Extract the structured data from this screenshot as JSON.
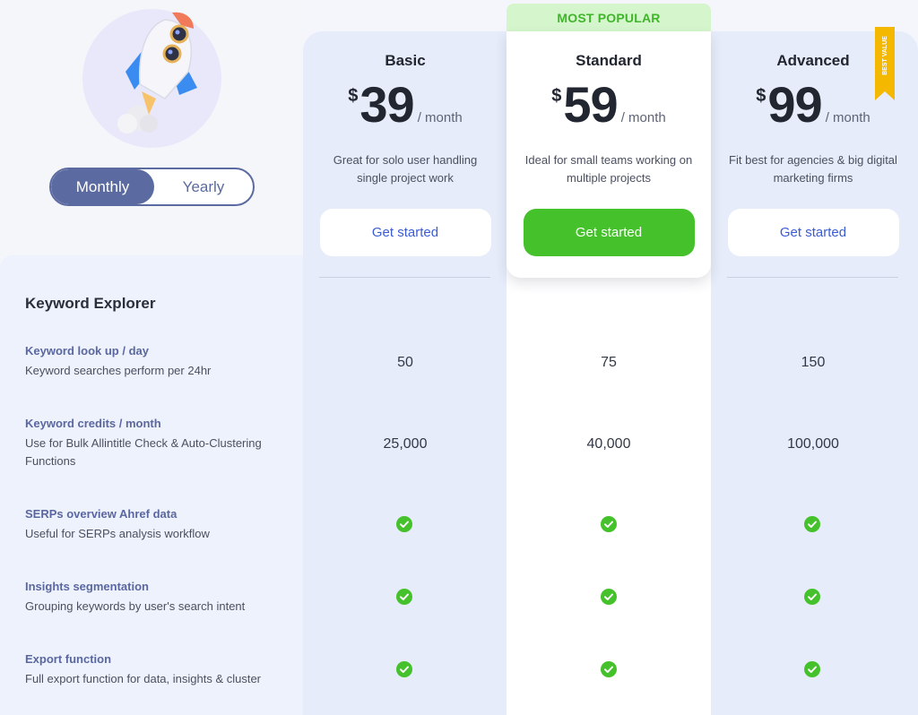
{
  "toggle": {
    "monthly": "Monthly",
    "yearly": "Yearly",
    "selected": "Monthly"
  },
  "popular_tag": "MOST POPULAR",
  "ribbon": "BEST VALUE",
  "plans": [
    {
      "name": "Basic",
      "currency": "$",
      "price": "39",
      "period": "/ month",
      "desc1": "Great for solo user handling",
      "desc2": "single project work",
      "cta": "Get started"
    },
    {
      "name": "Standard",
      "currency": "$",
      "price": "59",
      "period": "/ month",
      "desc1": "Ideal for small teams working on",
      "desc2": "multiple projects",
      "cta": "Get started"
    },
    {
      "name": "Advanced",
      "currency": "$",
      "price": "99",
      "period": "/ month",
      "desc1": "Fit best for agencies & big digital",
      "desc2": "marketing firms",
      "cta": "Get started"
    }
  ],
  "section_title": "Keyword Explorer",
  "features": [
    {
      "title": "Keyword look up / day",
      "desc": "Keyword searches perform per 24hr",
      "values": [
        "50",
        "75",
        "150"
      ]
    },
    {
      "title": "Keyword credits / month",
      "desc": "Use for Bulk Allintitle Check & Auto-Clustering Functions",
      "values": [
        "25,000",
        "40,000",
        "100,000"
      ]
    },
    {
      "title": "SERPs overview Ahref data",
      "desc": "Useful for SERPs analysis workflow",
      "values": [
        "check",
        "check",
        "check"
      ]
    },
    {
      "title": "Insights segmentation",
      "desc": "Grouping keywords by user's search intent",
      "values": [
        "check",
        "check",
        "check"
      ]
    },
    {
      "title": "Export function",
      "desc": "Full export function for data, insights & cluster",
      "values": [
        "check",
        "check",
        "check"
      ]
    }
  ],
  "colors": {
    "accent": "#5b6aa0",
    "green": "#45c22b",
    "link": "#3a5bd6",
    "ribbon": "#f5b800"
  }
}
